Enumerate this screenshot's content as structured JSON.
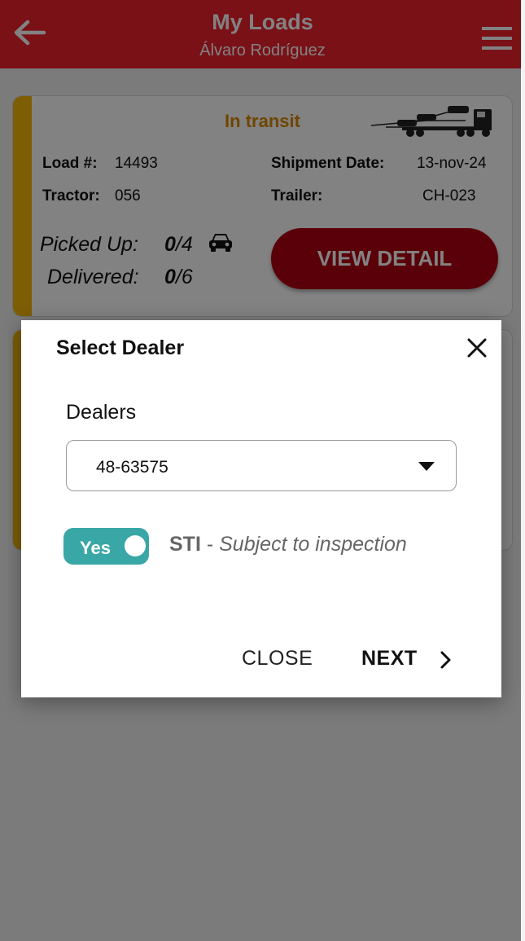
{
  "appbar": {
    "title": "My Loads",
    "subtitle": "Álvaro Rodríguez",
    "back_icon": "arrow-left-icon",
    "menu_icon": "hamburger-menu-icon",
    "color": "#f0222e"
  },
  "load_card": {
    "status": "In transit",
    "status_color": "#d98a00",
    "load_label": "Load #:",
    "load_value": "14493",
    "shipment_label": "Shipment Date:",
    "shipment_value": "13-nov-24",
    "tractor_label": "Tractor:",
    "tractor_value": "056",
    "trailer_label": "Trailer:",
    "trailer_value": "CH-023",
    "picked_label": "Picked Up:",
    "picked_done": "0",
    "picked_total": "/4",
    "delivered_label": "Delivered:",
    "delivered_done": "0",
    "delivered_total": "/6",
    "view_button": "VIEW DETAIL",
    "button_color": "#b00010",
    "stripe_color": "#f5b80a"
  },
  "dialog": {
    "title": "Select Dealer",
    "field_label": "Dealers",
    "selected_dealer": "48-63575",
    "toggle_label": "Yes",
    "toggle_on": true,
    "toggle_color": "#3aa7a7",
    "sti_code": "STI",
    "sti_separator": " - ",
    "sti_description": "Subject to inspection",
    "close_button": "CLOSE",
    "next_button": "NEXT"
  }
}
